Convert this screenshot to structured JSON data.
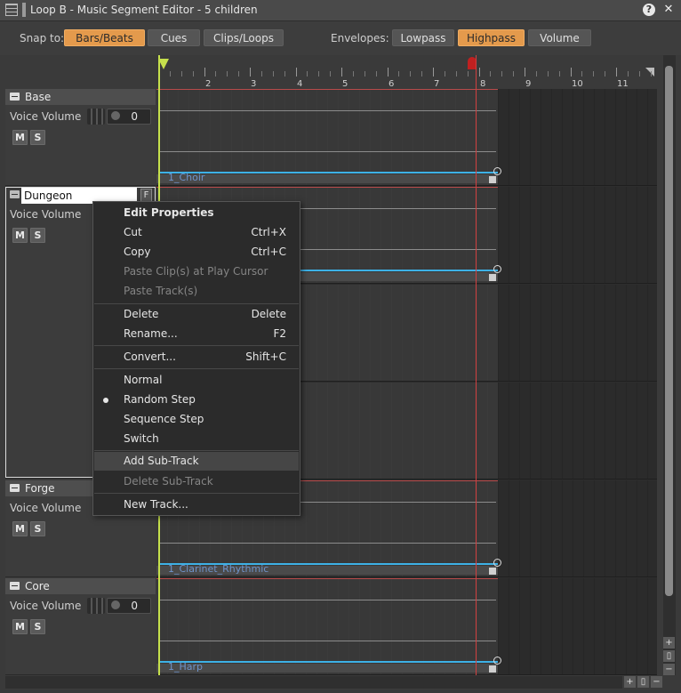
{
  "window": {
    "title": "Loop B - Music Segment Editor - 5 children",
    "help_label": "?",
    "close_label": "✕"
  },
  "toolbar": {
    "snap_label": "Snap to:",
    "snap_options": [
      {
        "label": "Bars/Beats",
        "active": true
      },
      {
        "label": "Cues",
        "active": false
      },
      {
        "label": "Clips/Loops",
        "active": false
      }
    ],
    "envelopes_label": "Envelopes:",
    "envelope_options": [
      {
        "label": "Lowpass",
        "active": false
      },
      {
        "label": "Highpass",
        "active": true
      },
      {
        "label": "Volume",
        "active": false
      }
    ]
  },
  "ruler": {
    "bars": [
      "2",
      "3",
      "4",
      "5",
      "6",
      "7",
      "8",
      "9",
      "10",
      "11"
    ]
  },
  "tracks": [
    {
      "name": "Base",
      "voice_label": "Voice Volume",
      "volume": "0",
      "mute": "M",
      "solo": "S",
      "clip": "1_Choir"
    },
    {
      "name": "Dungeon",
      "voice_label": "Voice Volume",
      "mute": "M",
      "solo": "S",
      "f_label": "F"
    },
    {
      "name": "Forge",
      "voice_label": "Voice Volume",
      "mute": "M",
      "solo": "S",
      "clip": "1_Clarinet_Rhythmic"
    },
    {
      "name": "Core",
      "voice_label": "Voice Volume",
      "volume": "0",
      "mute": "M",
      "solo": "S",
      "clip": "1_Harp"
    }
  ],
  "context_menu": {
    "items": [
      {
        "label": "Edit Properties",
        "shortcut": "",
        "bold": true
      },
      {
        "label": "Cut",
        "shortcut": "Ctrl+X"
      },
      {
        "label": "Copy",
        "shortcut": "Ctrl+C"
      },
      {
        "label": "Paste Clip(s) at Play Cursor",
        "shortcut": "",
        "disabled": true
      },
      {
        "label": "Paste Track(s)",
        "shortcut": "",
        "disabled": true
      },
      {
        "label": "Delete",
        "shortcut": "Delete"
      },
      {
        "label": "Rename...",
        "shortcut": "F2"
      },
      {
        "label": "Convert...",
        "shortcut": "Shift+C"
      },
      {
        "label": "Normal",
        "shortcut": ""
      },
      {
        "label": "Random Step",
        "shortcut": "",
        "checked": true
      },
      {
        "label": "Sequence Step",
        "shortcut": ""
      },
      {
        "label": "Switch",
        "shortcut": ""
      },
      {
        "label": "Add Sub-Track",
        "shortcut": "",
        "highlighted": true
      },
      {
        "label": "Delete Sub-Track",
        "shortcut": "",
        "disabled": true
      },
      {
        "label": "New Track...",
        "shortcut": ""
      }
    ]
  },
  "colors": {
    "accent": "#e49a4c",
    "clip_line": "#3db1e6",
    "playhead": "#c6e04c",
    "end_marker": "#d04040"
  }
}
